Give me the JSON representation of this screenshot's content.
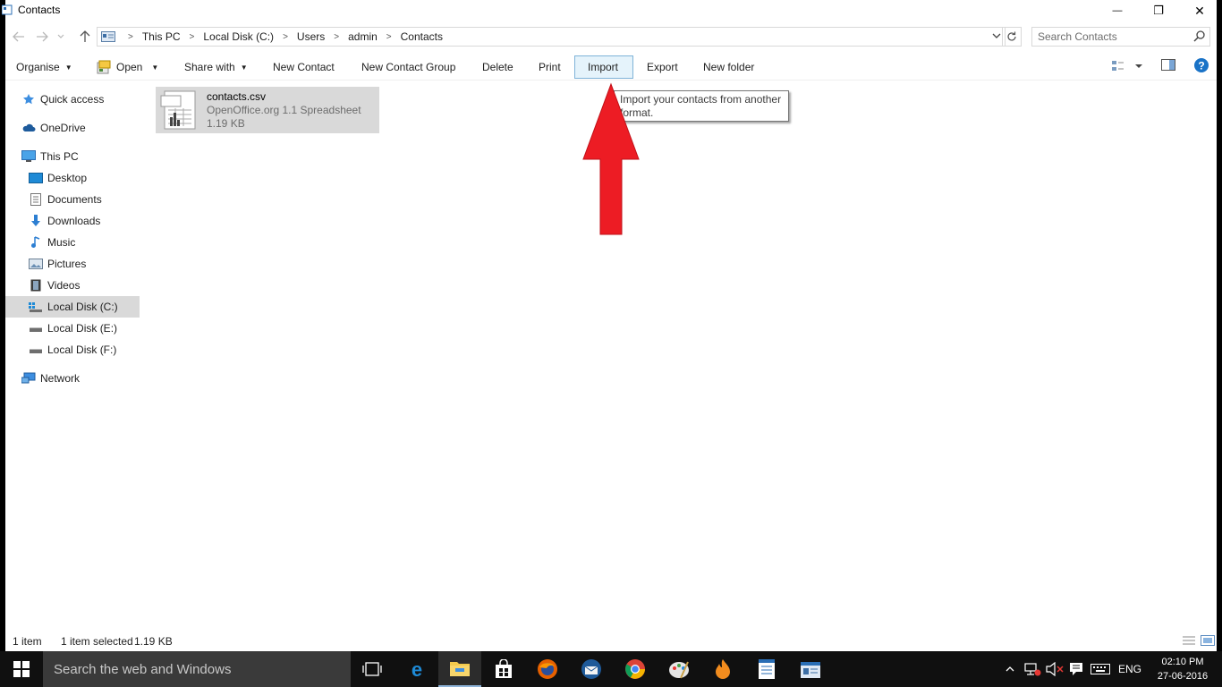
{
  "window": {
    "title": "Contacts",
    "minimize_glyph": "—",
    "restore_glyph": "❐",
    "close_glyph": "✕"
  },
  "address": {
    "crumbs": [
      "This PC",
      "Local Disk (C:)",
      "Users",
      "admin",
      "Contacts"
    ],
    "search_placeholder": "Search Contacts"
  },
  "toolbar": {
    "organise": "Organise",
    "open": "Open",
    "share_with": "Share with",
    "new_contact": "New Contact",
    "new_contact_group": "New Contact Group",
    "delete": "Delete",
    "print": "Print",
    "import": "Import",
    "export": "Export",
    "new_folder": "New folder",
    "help": "?"
  },
  "nav": {
    "quick_access": "Quick access",
    "onedrive": "OneDrive",
    "this_pc": "This PC",
    "desktop": "Desktop",
    "documents": "Documents",
    "downloads": "Downloads",
    "music": "Music",
    "pictures": "Pictures",
    "videos": "Videos",
    "local_c": "Local Disk (C:)",
    "local_e": "Local Disk (E:)",
    "local_f": "Local Disk (F:)",
    "network": "Network"
  },
  "file": {
    "name": "contacts.csv",
    "type": "OpenOffice.org 1.1 Spreadsheet",
    "size": "1.19 KB"
  },
  "tooltip": {
    "text": "Import your contacts from another format."
  },
  "status": {
    "count": "1 item",
    "selected": "1 item selected",
    "size": "1.19 KB"
  },
  "taskbar": {
    "search": "Search the web and Windows",
    "apps": [
      "task-view",
      "edge",
      "file-explorer",
      "store",
      "firefox",
      "thunderbird",
      "chrome",
      "paint",
      "nero",
      "wordpad",
      "outlook"
    ],
    "language": "ENG",
    "time": "02:10 PM",
    "date": "27-06-2016"
  },
  "colors": {
    "selection": "#d9d9d9",
    "active_button": "#e5f3fb",
    "arrow": "#ed1c24",
    "help_icon": "#1a73c7",
    "taskbar": "#101010"
  }
}
